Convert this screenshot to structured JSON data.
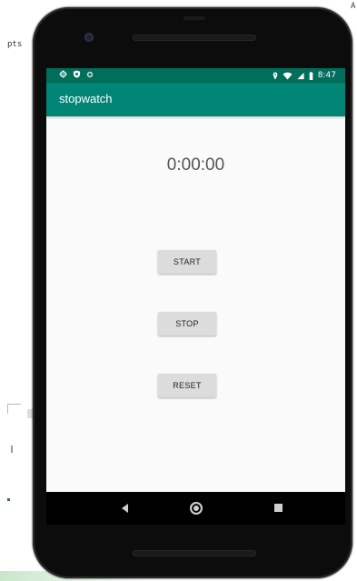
{
  "background": {
    "left_text": "pts",
    "right_text": "A"
  },
  "status_bar": {
    "time": "8:47",
    "left_icons": [
      "settings-icon",
      "shield-icon",
      "sync-icon"
    ],
    "right_icons": [
      "location-icon",
      "wifi-icon",
      "signal-icon",
      "battery-icon"
    ]
  },
  "app_bar": {
    "title": "stopwatch"
  },
  "timer": {
    "display": "0:00:00"
  },
  "buttons": {
    "start": "START",
    "stop": "STOP",
    "reset": "RESET"
  },
  "nav_bar": {
    "icons": [
      "back-icon",
      "home-icon",
      "recent-apps-icon"
    ]
  },
  "colors": {
    "status_bar": "#006e5a",
    "app_bar": "#008577",
    "screen_background": "#fafafa",
    "button_background": "#dcdcdc",
    "phone_frame": "#0c0c0c"
  }
}
